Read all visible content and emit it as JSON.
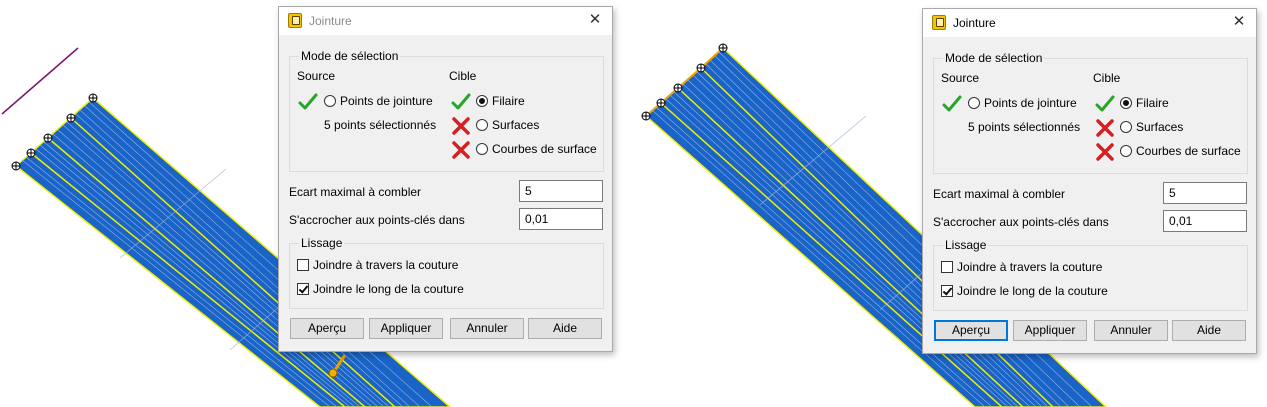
{
  "panels": [
    {
      "dialog": {
        "title": "Jointure",
        "state": "inactive",
        "selection_group": {
          "title": "Mode de sélection",
          "source": {
            "header": "Source",
            "option": {
              "label": "Points de jointure",
              "selected": false,
              "status": "check"
            },
            "info": "5 points sélectionnés"
          },
          "target": {
            "header": "Cible",
            "options": [
              {
                "label": "Filaire",
                "selected": true,
                "status": "check"
              },
              {
                "label": "Surfaces",
                "selected": false,
                "status": "cross"
              },
              {
                "label": "Courbes de surface",
                "selected": false,
                "status": "cross"
              }
            ]
          }
        },
        "fields": [
          {
            "label": "Ecart maximal à combler",
            "value": "5"
          },
          {
            "label": "S'accrocher aux points-clés dans",
            "value": "0,01"
          }
        ],
        "smoothing_group": {
          "title": "Lissage",
          "options": [
            {
              "label": "Joindre à travers la couture",
              "checked": false
            },
            {
              "label": "Joindre le long de la couture",
              "checked": true
            }
          ]
        },
        "buttons": [
          {
            "label": "Aperçu",
            "focused": false
          },
          {
            "label": "Appliquer"
          },
          {
            "label": "Annuler"
          },
          {
            "label": "Aide"
          }
        ]
      }
    },
    {
      "dialog": {
        "title": "Jointure",
        "state": "active",
        "selection_group": {
          "title": "Mode de sélection",
          "source": {
            "header": "Source",
            "option": {
              "label": "Points de jointure",
              "selected": false,
              "status": "check"
            },
            "info": "5 points sélectionnés"
          },
          "target": {
            "header": "Cible",
            "options": [
              {
                "label": "Filaire",
                "selected": true,
                "status": "check"
              },
              {
                "label": "Surfaces",
                "selected": false,
                "status": "cross"
              },
              {
                "label": "Courbes de surface",
                "selected": false,
                "status": "cross"
              }
            ]
          }
        },
        "fields": [
          {
            "label": "Ecart maximal à combler",
            "value": "5"
          },
          {
            "label": "S'accrocher aux points-clés dans",
            "value": "0,01"
          }
        ],
        "smoothing_group": {
          "title": "Lissage",
          "options": [
            {
              "label": "Joindre à travers la couture",
              "checked": false
            },
            {
              "label": "Joindre le long de la couture",
              "checked": true
            }
          ]
        },
        "buttons": [
          {
            "label": "Aperçu",
            "focused": true
          },
          {
            "label": "Appliquer"
          },
          {
            "label": "Annuler"
          },
          {
            "label": "Aide"
          }
        ]
      }
    }
  ],
  "colors": {
    "surface_fill": "#1a64c8",
    "surface_edge": "#f0f000",
    "surface_line": "#e0e020",
    "gray_line": "#9ab4d8",
    "selected_edge": "#f0a000",
    "check_green": "#26a626",
    "cross_red": "#d42020",
    "focus_blue": "#0078d7"
  }
}
